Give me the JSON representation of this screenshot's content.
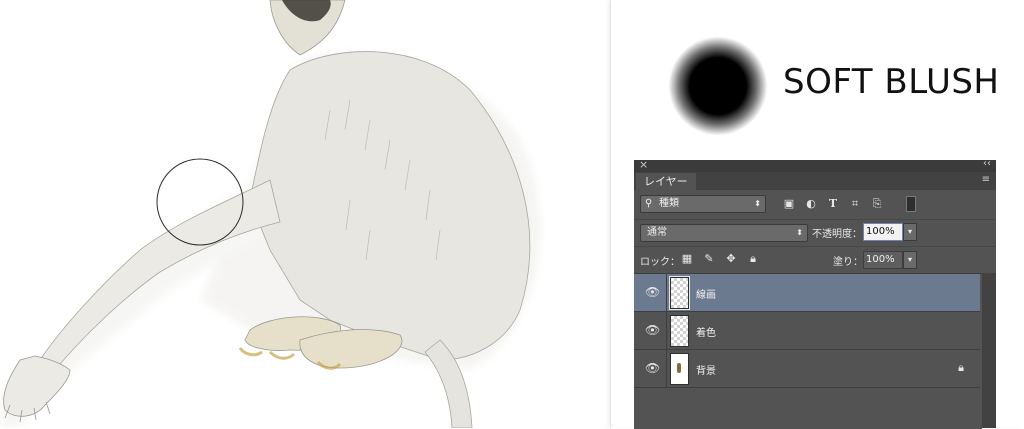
{
  "right_info": {
    "brush_label": "SOFT BLUSH"
  },
  "layers_panel": {
    "close_glyph": "×",
    "collapse_glyph": "‹‹",
    "tab_label": "レイヤー",
    "menu_glyph": "≡",
    "filter": {
      "value": "種類",
      "icon": "search-icon"
    },
    "filter_icons": [
      "image-filter-icon",
      "adjustment-filter-icon",
      "type-filter-icon",
      "shape-filter-icon",
      "smart-object-filter-icon",
      "filter-toggle-icon"
    ],
    "blend_mode": "通常",
    "opacity_label": "不透明度：",
    "opacity_value": "100%",
    "lock_label": "ロック：",
    "lock_icons": [
      "lock-transparent-icon",
      "lock-image-icon",
      "lock-position-icon",
      "lock-all-icon"
    ],
    "fill_label": "塗り：",
    "fill_value": "100%",
    "layers": [
      {
        "name": "線画",
        "visible": true,
        "selected": true,
        "locked": false
      },
      {
        "name": "着色",
        "visible": true,
        "selected": false,
        "locked": false
      },
      {
        "name": "背景",
        "visible": true,
        "selected": false,
        "locked": true
      }
    ]
  },
  "colors": {
    "panel_bg": "#535353",
    "selected_layer": "#6c7a90",
    "sketch_fill": "#e8e6e1",
    "accent_yellow": "#c9a24a"
  }
}
